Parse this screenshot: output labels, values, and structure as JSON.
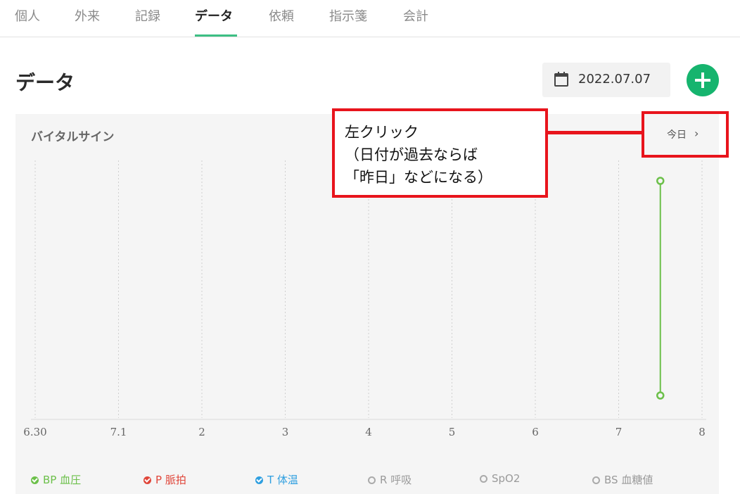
{
  "tabs": [
    {
      "label": "個人",
      "active": false
    },
    {
      "label": "外来",
      "active": false
    },
    {
      "label": "記録",
      "active": false
    },
    {
      "label": "データ",
      "active": true
    },
    {
      "label": "依頼",
      "active": false
    },
    {
      "label": "指示箋",
      "active": false
    },
    {
      "label": "会計",
      "active": false
    }
  ],
  "header": {
    "title": "データ",
    "date": "2022.07.07",
    "date_icon": "calendar-icon",
    "add_icon": "plus-icon"
  },
  "panel": {
    "title": "バイタルサイン",
    "today_label": "今日",
    "today_icon": "chevron-right-icon"
  },
  "chart_data": {
    "type": "line",
    "x_ticks": [
      "6.30",
      "7.1",
      "2",
      "3",
      "4",
      "5",
      "6",
      "7",
      "8"
    ],
    "series": [
      {
        "name": "BP 血圧",
        "color": "#6cc04a",
        "points": [
          {
            "x": 7.5,
            "low": 0.0,
            "high": 1.0
          }
        ]
      }
    ],
    "grid": "vertical-dotted"
  },
  "legend": [
    {
      "label": "BP 血圧",
      "color": "#6cc04a",
      "checked": true
    },
    {
      "label": "P 脈拍",
      "color": "#e0463a",
      "checked": true
    },
    {
      "label": "T 体温",
      "color": "#2f9fe0",
      "checked": true
    },
    {
      "label": "R 呼吸",
      "color": "#9a9a9a",
      "checked": false
    },
    {
      "label": "SpO2",
      "color": "#9a9a9a",
      "checked": false
    },
    {
      "label": "BS 血糖値",
      "color": "#9a9a9a",
      "checked": false
    }
  ],
  "annotation": {
    "lines": [
      "左クリック",
      "（日付が過去ならば",
      "「昨日」などになる）"
    ],
    "color": "#e8141c"
  }
}
